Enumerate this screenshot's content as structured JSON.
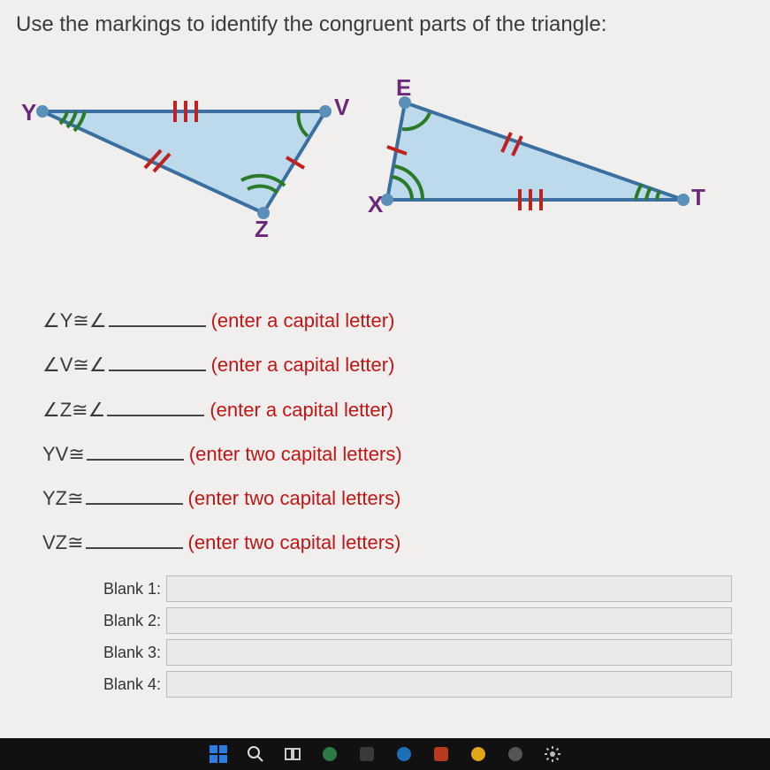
{
  "prompt": "Use the markings to identify the congruent parts of the triangle:",
  "triangle1": {
    "vertices": [
      "Y",
      "V",
      "Z"
    ]
  },
  "triangle2": {
    "vertices": [
      "E",
      "X",
      "T"
    ]
  },
  "statements": [
    {
      "lhs": "∠Y≅∠",
      "hint": "(enter a capital letter)"
    },
    {
      "lhs": "∠V≅∠",
      "hint": "(enter a capital letter)"
    },
    {
      "lhs": "∠Z≅∠",
      "hint": "(enter a capital letter)"
    },
    {
      "lhs": "YV≅",
      "hint": "(enter two capital letters)"
    },
    {
      "lhs": "YZ≅",
      "hint": "(enter two capital letters)"
    },
    {
      "lhs": "VZ≅",
      "hint": "(enter two capital letters)"
    }
  ],
  "blanks": [
    {
      "label": "Blank 1:",
      "value": ""
    },
    {
      "label": "Blank 2:",
      "value": ""
    },
    {
      "label": "Blank 3:",
      "value": ""
    },
    {
      "label": "Blank 4:",
      "value": ""
    }
  ]
}
